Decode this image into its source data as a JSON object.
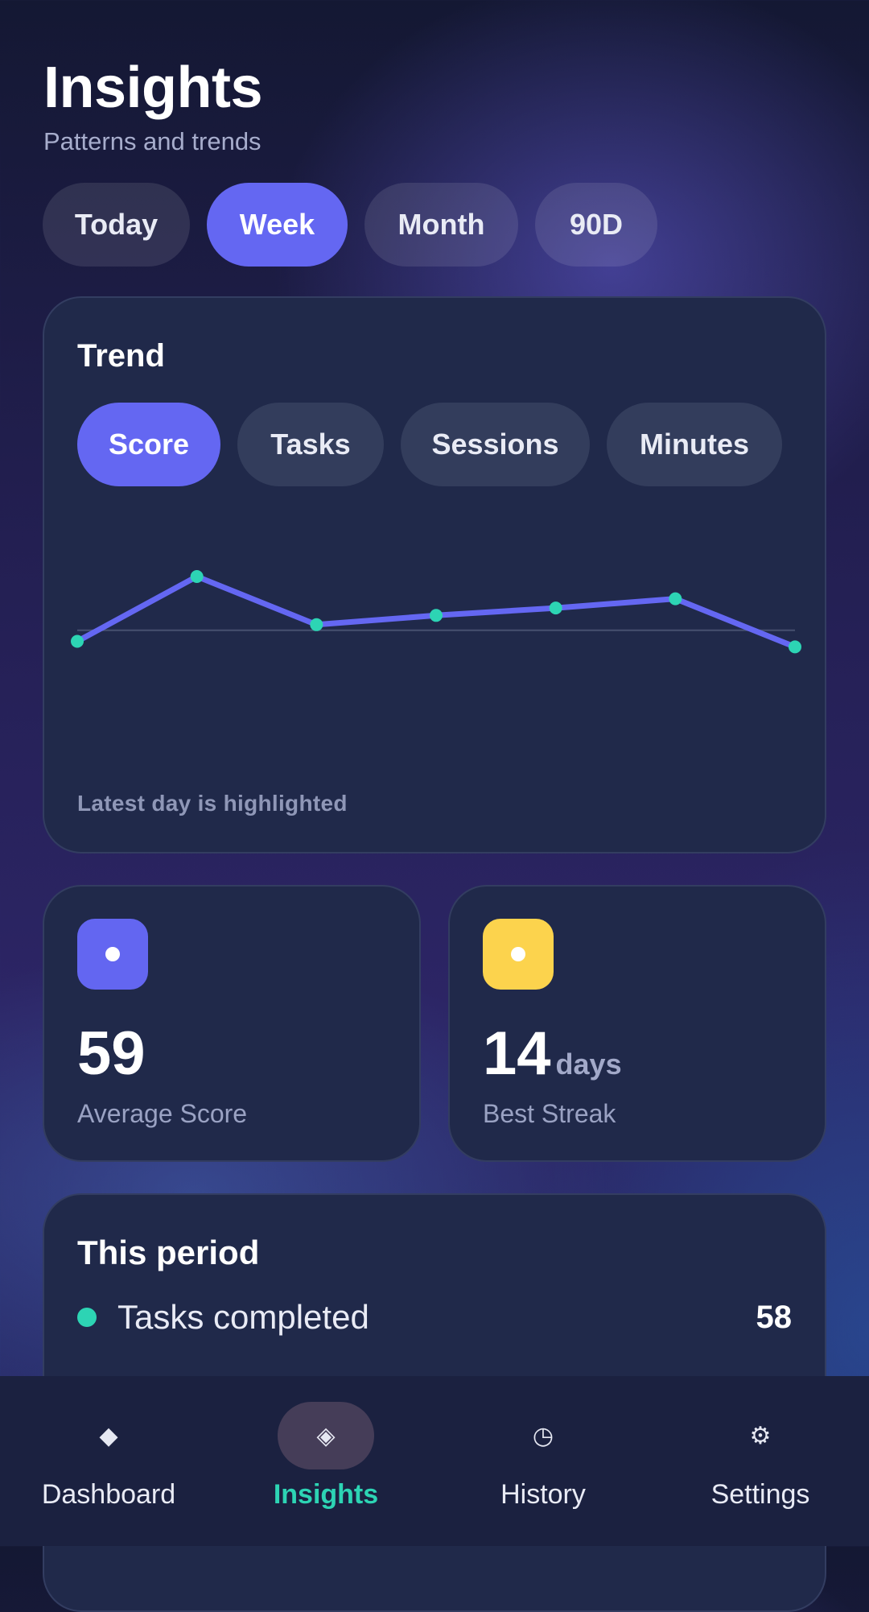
{
  "header": {
    "title": "Insights",
    "subtitle": "Patterns and trends"
  },
  "ranges": {
    "selected": "Week",
    "items": [
      "Today",
      "Week",
      "Month",
      "90D"
    ]
  },
  "trend": {
    "title": "Trend",
    "metrics": [
      "Score",
      "Tasks",
      "Sessions",
      "Minutes"
    ],
    "selected_metric": "Score",
    "caption": "Latest day is highlighted"
  },
  "chart_data": {
    "type": "line",
    "title": "",
    "x": [
      1,
      2,
      3,
      4,
      5,
      6,
      7
    ],
    "series": [
      {
        "values": [
          45,
          80,
          54,
          59,
          63,
          68,
          42
        ]
      }
    ],
    "ylim": [
      0,
      100
    ],
    "baseline": 51,
    "grid": false,
    "line_color": "#6467f2",
    "point_color": "#2dd4b4"
  },
  "stats": {
    "average": {
      "value": "59",
      "label": "Average Score",
      "icon_color": "#6366f1"
    },
    "streak": {
      "value": "14",
      "unit": "days",
      "label": "Best Streak",
      "icon_color": "#fcd34d"
    }
  },
  "period": {
    "title": "This period",
    "rows": [
      {
        "label": "Tasks completed",
        "value": "58",
        "dot_color": "#2dd4b4"
      }
    ]
  },
  "nav": {
    "items": [
      {
        "label": "Dashboard",
        "icon": "diamond-icon",
        "glyph": "◆"
      },
      {
        "label": "Insights",
        "icon": "insights-icon",
        "glyph": "◈"
      },
      {
        "label": "History",
        "icon": "clock-icon",
        "glyph": "◷"
      },
      {
        "label": "Settings",
        "icon": "gear-icon",
        "glyph": "⚙"
      }
    ],
    "active": "Insights"
  }
}
